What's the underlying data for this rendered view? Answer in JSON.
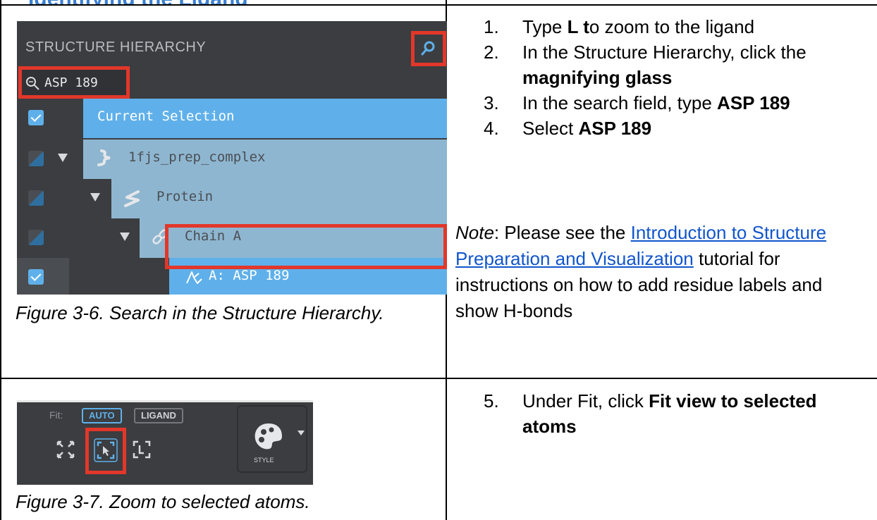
{
  "heading_fragment": "Identifying the Ligand",
  "figure_3_6": {
    "panel_title": "STRUCTURE HIERARCHY",
    "search_value": "ASP 189",
    "rows": [
      {
        "label": "Current Selection"
      },
      {
        "label": "1fjs_prep_complex"
      },
      {
        "label": "Protein"
      },
      {
        "label": "Chain A"
      },
      {
        "label": "A: ASP 189"
      }
    ],
    "caption": "Figure 3-6. Search in the Structure Hierarchy."
  },
  "steps_a": [
    {
      "num": "1.",
      "pre": "Type ",
      "bold": "L t",
      "post": "o zoom to the ligand"
    },
    {
      "num": "2.",
      "pre": "In the Structure Hierarchy, click the ",
      "bold": "magnifying glass",
      "post": ""
    },
    {
      "num": "3.",
      "pre": "In the search field, type ",
      "bold": "ASP 189",
      "post": ""
    },
    {
      "num": "4.",
      "pre": "Select ",
      "bold": "ASP 189",
      "post": ""
    }
  ],
  "note": {
    "label": "Note",
    "colon": ": Please see the ",
    "link": "Introduction to Structure Preparation and Visualization",
    "rest": " tutorial for instructions on how to add residue labels and show H-bonds"
  },
  "figure_3_7": {
    "fit_label": "Fit:",
    "auto_label": "AUTO",
    "ligand_label": "LIGAND",
    "style_label": "STYLE",
    "caption": "Figure 3-7. Zoom to selected atoms."
  },
  "steps_b": [
    {
      "num": "5.",
      "pre": "Under Fit, click ",
      "bold": "Fit view to selected atoms",
      "post": ""
    }
  ],
  "colors": {
    "highlight_red": "#e2372a",
    "selection_blue": "#5fb0ea",
    "link_blue": "#1155cc",
    "panel_bg": "#3b3d40"
  }
}
